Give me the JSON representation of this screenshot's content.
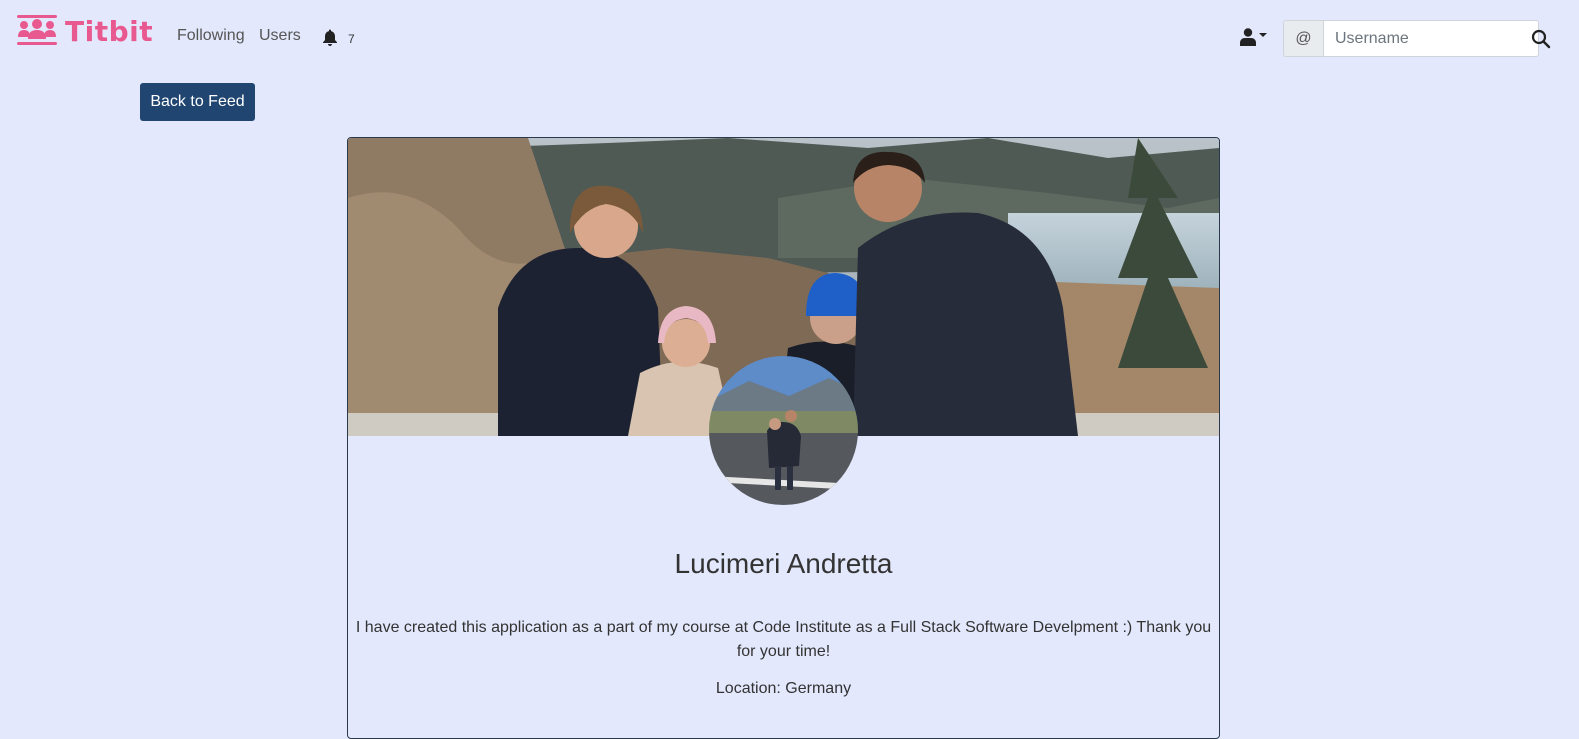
{
  "brand": {
    "name": "Titbit",
    "color": "#e85a8f"
  },
  "nav": {
    "following_label": "Following",
    "users_label": "Users",
    "notification_count": "7"
  },
  "search": {
    "prefix": "@",
    "placeholder": "Username"
  },
  "actions": {
    "back_label": "Back to Feed"
  },
  "profile": {
    "name": "Lucimeri Andretta",
    "bio": "I have created this application as a part of my course at Code Institute as a Full Stack Software Develpment :) Thank you for your time!",
    "location": "Location: Germany"
  },
  "colors": {
    "page_bg": "#e3e8fc",
    "button_bg": "#1f4570",
    "accent": "#e85a8f"
  }
}
